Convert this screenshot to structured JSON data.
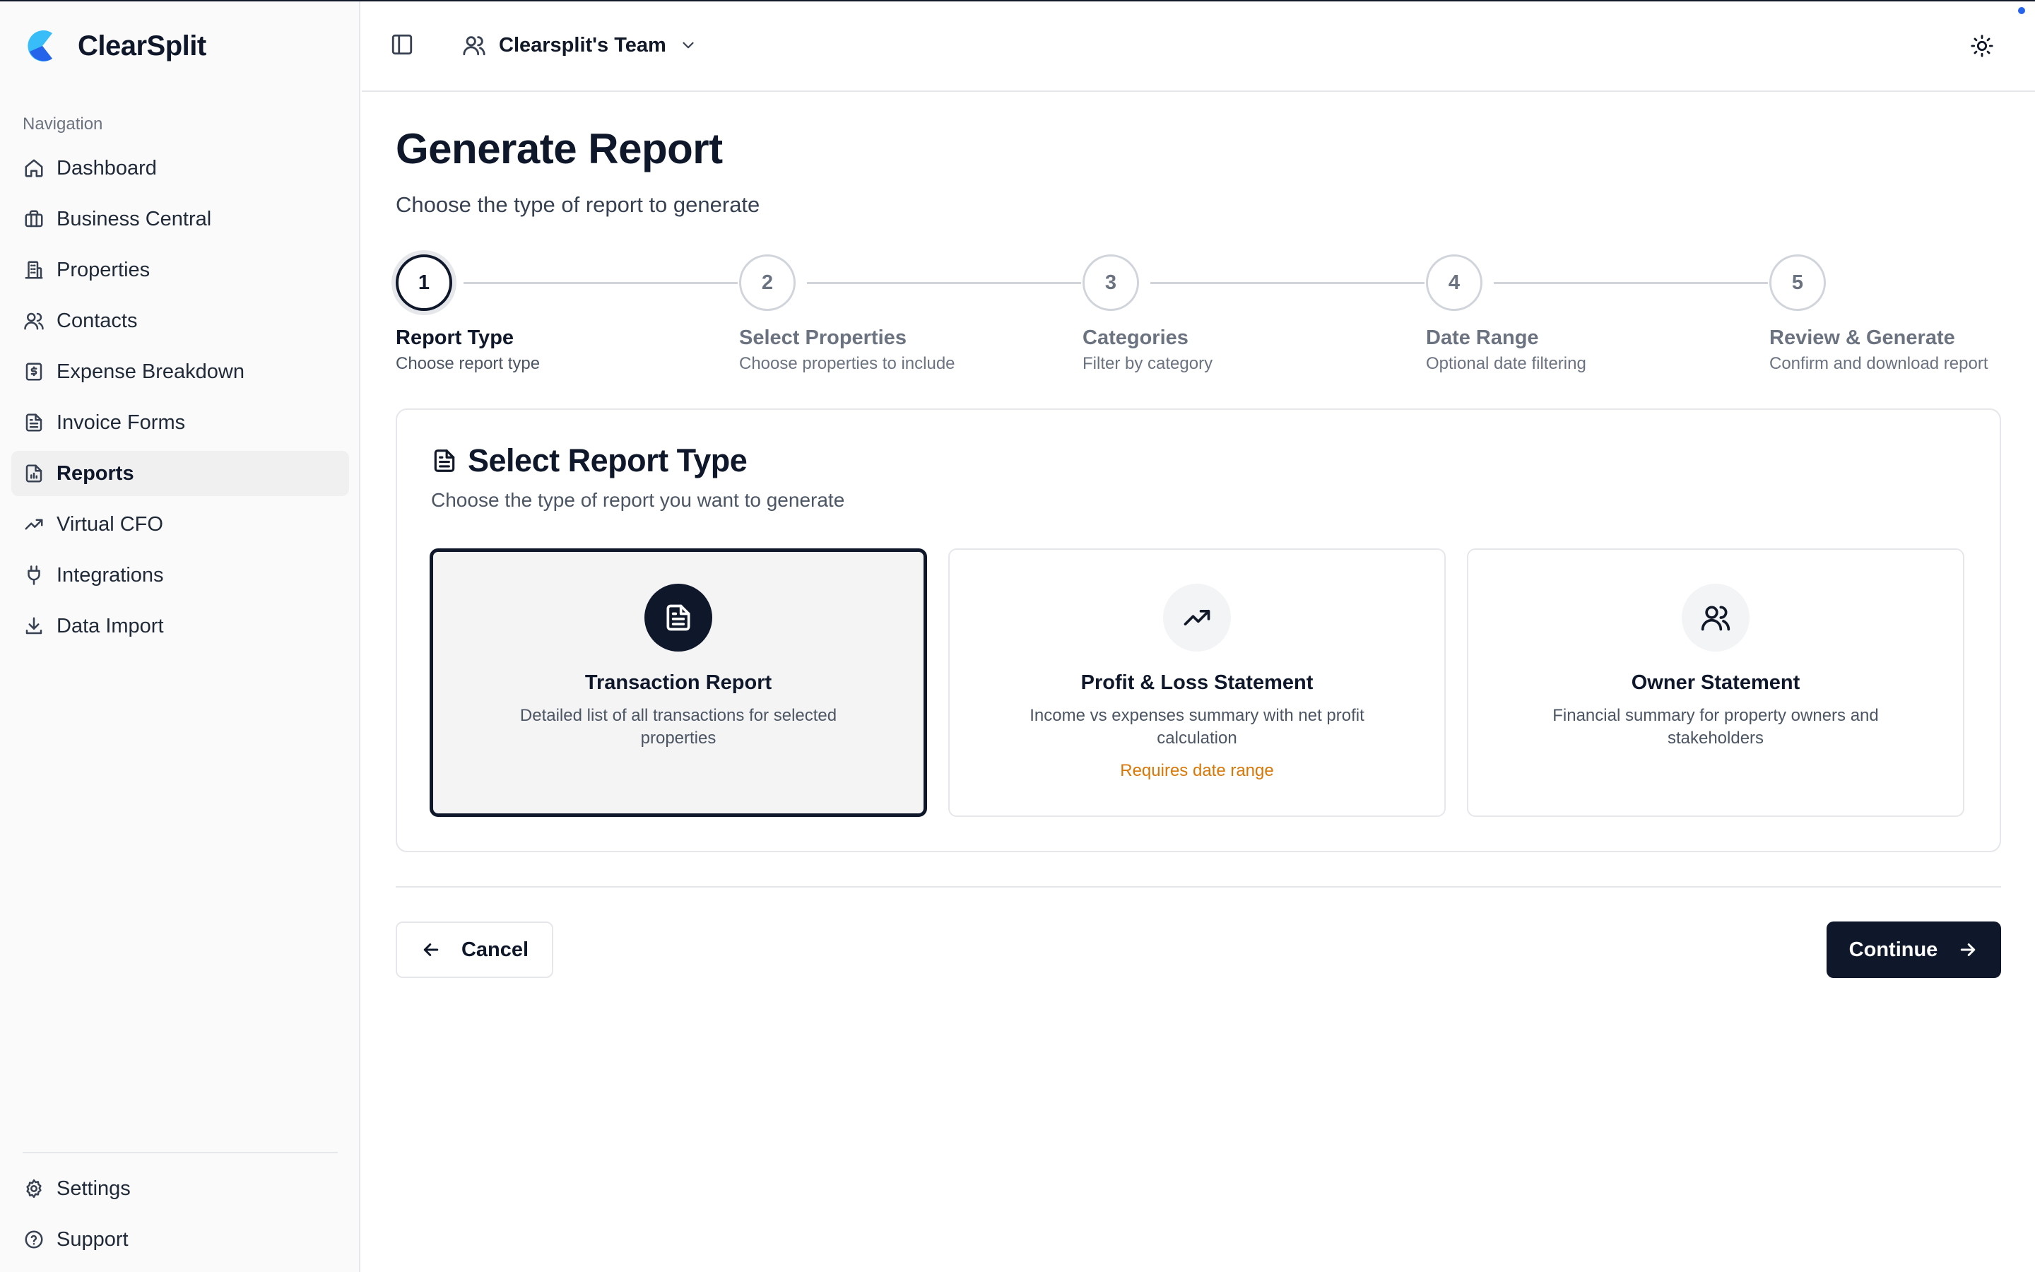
{
  "app": {
    "name": "ClearSplit",
    "accent_color": "#0f172a",
    "logo_colors": [
      "#38bdf8",
      "#2563eb"
    ]
  },
  "sidebar": {
    "heading": "Navigation",
    "items": [
      {
        "label": "Dashboard",
        "icon": "home-icon"
      },
      {
        "label": "Business Central",
        "icon": "briefcase-icon"
      },
      {
        "label": "Properties",
        "icon": "building-icon"
      },
      {
        "label": "Contacts",
        "icon": "users-icon"
      },
      {
        "label": "Expense Breakdown",
        "icon": "dollar-receipt-icon"
      },
      {
        "label": "Invoice Forms",
        "icon": "file-text-icon"
      },
      {
        "label": "Reports",
        "icon": "file-chart-icon",
        "active": true
      },
      {
        "label": "Virtual CFO",
        "icon": "trending-up-icon"
      },
      {
        "label": "Integrations",
        "icon": "plug-icon"
      },
      {
        "label": "Data Import",
        "icon": "download-icon"
      }
    ],
    "bottom_items": [
      {
        "label": "Settings",
        "icon": "gear-icon"
      },
      {
        "label": "Support",
        "icon": "help-circle-icon"
      }
    ]
  },
  "header": {
    "team_name": "Clearsplit's Team"
  },
  "page": {
    "title": "Generate Report",
    "subtitle": "Choose the type of report to generate"
  },
  "stepper": {
    "current_step": 1,
    "steps": [
      {
        "number": "1",
        "label": "Report Type",
        "desc": "Choose report type"
      },
      {
        "number": "2",
        "label": "Select Properties",
        "desc": "Choose properties to include"
      },
      {
        "number": "3",
        "label": "Categories",
        "desc": "Filter by category"
      },
      {
        "number": "4",
        "label": "Date Range",
        "desc": "Optional date filtering"
      },
      {
        "number": "5",
        "label": "Review & Generate",
        "desc": "Confirm and download report"
      }
    ]
  },
  "report_type_card": {
    "title": "Select Report Type",
    "subtitle": "Choose the type of report you want to generate",
    "options": [
      {
        "title": "Transaction Report",
        "desc": "Detailed list of all transactions for selected properties",
        "note": "",
        "icon": "file-text-icon",
        "selected": true
      },
      {
        "title": "Profit & Loss Statement",
        "desc": "Income vs expenses summary with net profit calculation",
        "note": "Requires date range",
        "icon": "trending-up-icon",
        "selected": false
      },
      {
        "title": "Owner Statement",
        "desc": "Financial summary for property owners and stakeholders",
        "note": "",
        "icon": "users-icon",
        "selected": false
      }
    ],
    "note_color": "#d97706"
  },
  "actions": {
    "cancel_label": "Cancel",
    "continue_label": "Continue"
  }
}
